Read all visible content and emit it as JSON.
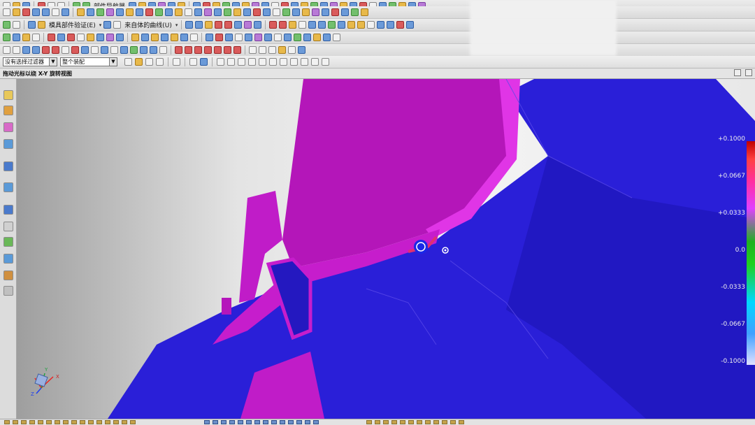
{
  "toolbar": {
    "row1_text": "部件导航器",
    "row2_text1": "模具部件验证(E)",
    "row2_text2": "来自体的曲线(U)"
  },
  "filter": {
    "type_filter": "没有选择过滤器",
    "scope": "整个装配"
  },
  "hint": {
    "text": "拖动光标以绕 X-Y 旋转视图"
  },
  "legend": {
    "ticks": [
      "+0.1000",
      "+0.0667",
      "+0.0333",
      "0.0",
      "-0.0333",
      "-0.0667",
      "-0.1000"
    ],
    "colors": {
      "top": "#c00000",
      "mid": "#1fd01f",
      "bottom": "#e0e0ff"
    }
  },
  "model": {
    "colors": {
      "magenta": "#c01cc8",
      "blue": "#2a1fd8",
      "highlight": "#e03070"
    }
  },
  "triad": {
    "x_label": "X",
    "y_label": "Y",
    "z_label": "Z"
  }
}
